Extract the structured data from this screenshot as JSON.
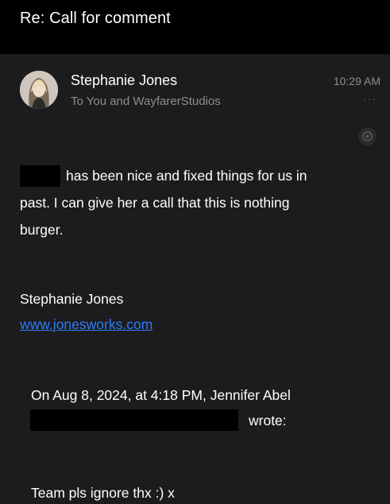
{
  "header": {
    "subject": "Re: Call for comment"
  },
  "message": {
    "sender": "Stephanie Jones",
    "recipients": "To You and WayfarerStudios",
    "time": "10:29 AM",
    "more_glyph": "···",
    "reply_icon": "reply-icon"
  },
  "body": {
    "line1": "has been nice and fixed things for us in",
    "line2": "past. I can give her a call that this is nothing",
    "line3": "burger."
  },
  "signature": {
    "name": "Stephanie Jones",
    "link": "www.jonesworks.com"
  },
  "quote": {
    "intro": "On Aug 8, 2024, at 4:18 PM, Jennifer Abel",
    "wrote": "wrote:",
    "text": "Team pls ignore thx :) x"
  },
  "colors": {
    "background": "#000000",
    "mail_body": "#1c1c1e",
    "secondary_text": "#8d8d92",
    "link": "#2f7bf6"
  }
}
